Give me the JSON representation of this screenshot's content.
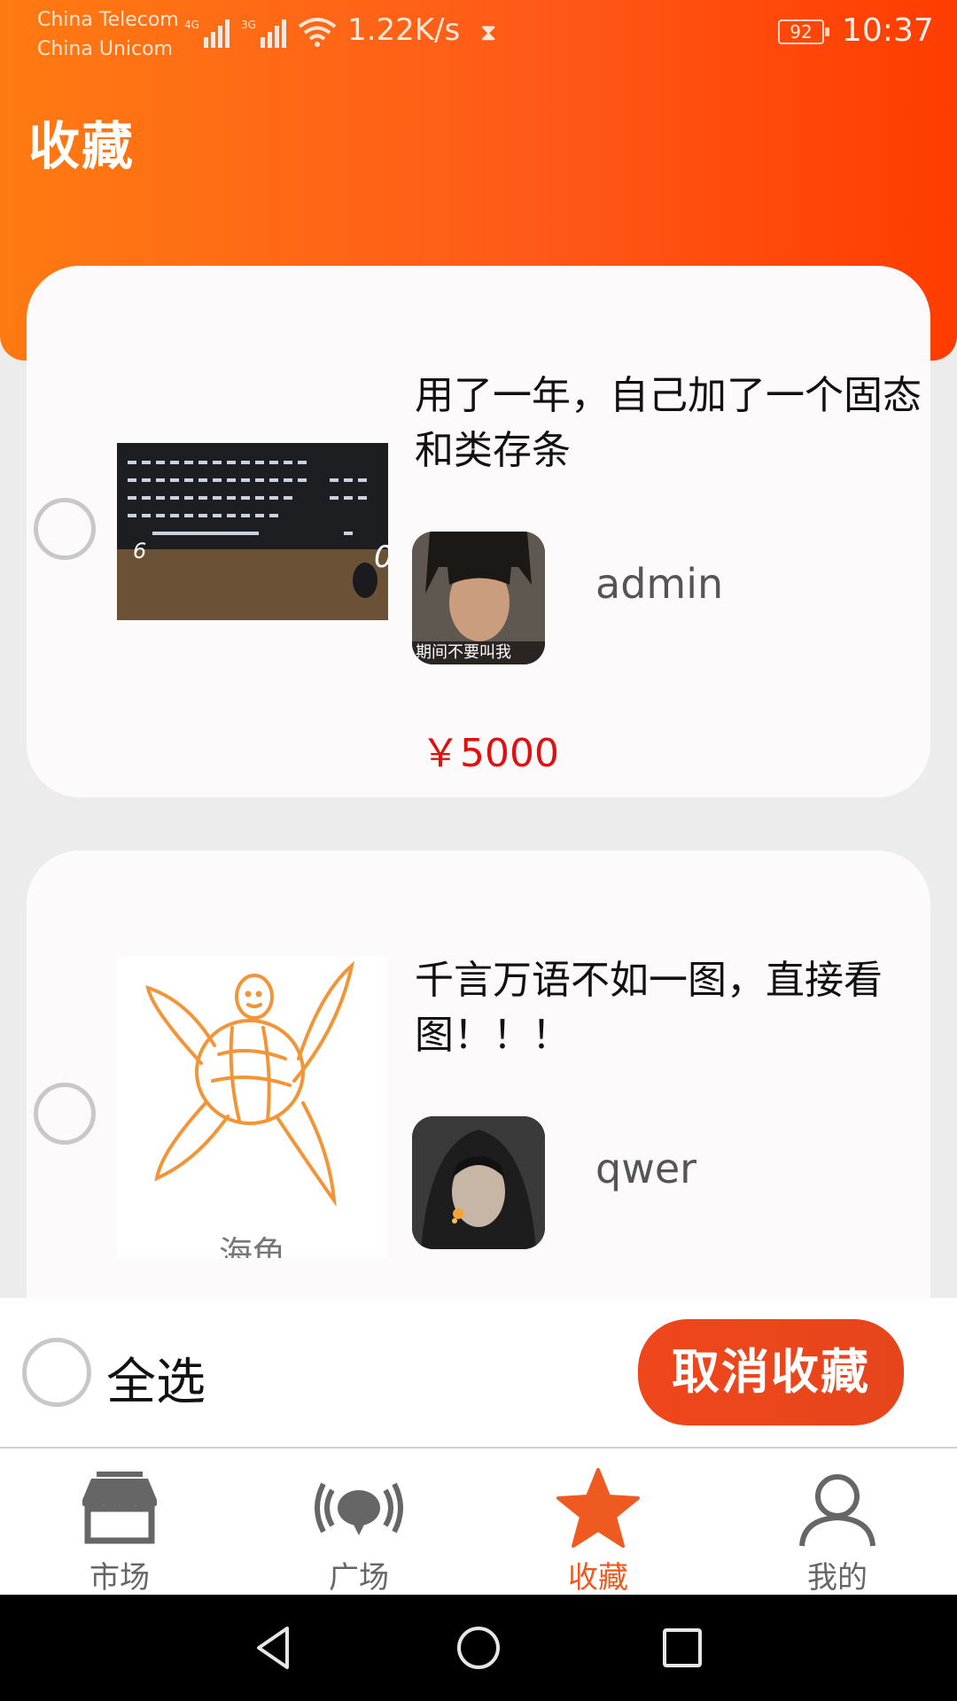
{
  "status_bar": {
    "carrier1": "China Telecom",
    "carrier2": "China Unicom",
    "net1": "4G",
    "net2": "3G",
    "speed": "1.22K/s",
    "battery": "92",
    "time": "10:37"
  },
  "page": {
    "title": "收藏"
  },
  "favorites": [
    {
      "title": "用了一年，自己加了一个固态和类存条",
      "username": "admin",
      "avatar_caption": "期间不要叫我",
      "price": "￥5000"
    },
    {
      "title": "千言万语不如一图，直接看图！！！",
      "username": "qwer",
      "image_caption": "海龟"
    }
  ],
  "actions": {
    "select_all": "全选",
    "cancel_favorite": "取消收藏"
  },
  "tabbar": {
    "active_index": 2,
    "items": [
      {
        "label": "市场",
        "icon": "store-icon"
      },
      {
        "label": "广场",
        "icon": "broadcast-icon"
      },
      {
        "label": "收藏",
        "icon": "star-icon"
      },
      {
        "label": "我的",
        "icon": "user-icon"
      }
    ]
  },
  "colors": {
    "accent": "#ff5a18",
    "price": "#e01010",
    "active_tab": "#ee5a1f"
  }
}
